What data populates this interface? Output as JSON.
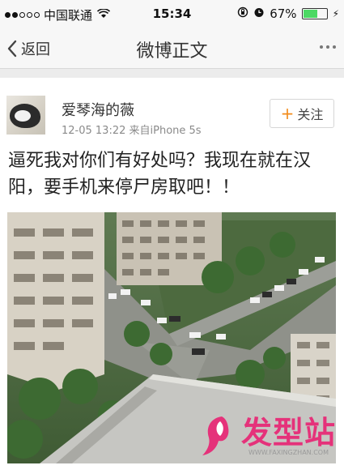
{
  "status_bar": {
    "carrier": "中国联通",
    "time": "15:34",
    "battery_percent": "67%",
    "battery_level": 0.67
  },
  "nav": {
    "back_label": "返回",
    "title": "微博正文"
  },
  "post": {
    "username": "爱琴海的薇",
    "timestamp": "12-05 13:22",
    "source": "来自iPhone 5s",
    "follow_label": "关注",
    "text": "逼死我对你们有好处吗？我现在就在汉阳，要手机来停尸房取吧！！"
  },
  "watermark": {
    "name": "发型站",
    "url": "WWW.FAXINGZHAN.COM"
  },
  "colors": {
    "follow_plus": "#f28c1b",
    "watermark": "#e5327a",
    "battery": "#4cd964"
  }
}
